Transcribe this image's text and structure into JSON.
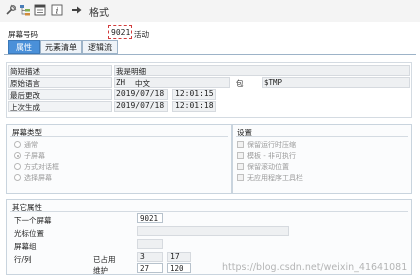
{
  "toolbar": {
    "format_label": "格式"
  },
  "header": {
    "screen_no_label": "屏幕号码",
    "screen_no_value": "9021",
    "status": "活动"
  },
  "tabs": [
    {
      "label": "属性"
    },
    {
      "label": "元素清单"
    },
    {
      "label": "逻辑流"
    }
  ],
  "attributes": {
    "short_desc_label": "简短描述",
    "short_desc_value": "我是明细",
    "orig_lang_label": "原始语言",
    "orig_lang_code": "ZH",
    "orig_lang_name": "中文",
    "package_label": "包",
    "package_value": "$TMP",
    "last_change_label": "最后更改",
    "last_change_date": "2019/07/18",
    "last_change_time": "12:01:15",
    "last_gen_label": "上次生成",
    "last_gen_date": "2019/07/18",
    "last_gen_time": "12:01:18"
  },
  "screen_type": {
    "title": "屏幕类型",
    "options": [
      "通常",
      "子屏幕",
      "方式对话框",
      "选择屏幕"
    ]
  },
  "settings": {
    "title": "设置",
    "options": [
      "保留运行时压缩",
      "模板 - 非可执行",
      "保留滚动位置",
      "无应用程序工具栏"
    ]
  },
  "other": {
    "title": "其它属性",
    "next_screen_label": "下一个屏幕",
    "next_screen_value": "9021",
    "cursor_label": "光标位置",
    "screen_group_label": "屏幕组",
    "rows_cols_label": "行/列",
    "used_label": "已占用",
    "used_rows": "3",
    "used_cols": "17",
    "maint_label": "维护",
    "maint_rows": "27",
    "maint_cols": "120"
  },
  "watermark": "https://blog.csdn.net/weixin_41641081"
}
